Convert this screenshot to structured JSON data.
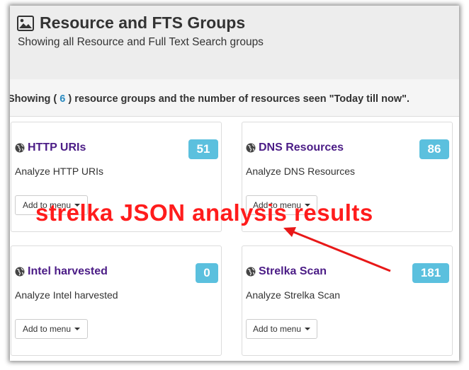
{
  "page": {
    "title": "Resource and FTS Groups",
    "subtitle": "Showing all Resource and Full Text Search groups"
  },
  "info": {
    "prefix": "Showing (",
    "count": "6",
    "suffix": ") resource groups and the number of resources seen \"Today till now\"."
  },
  "cards": [
    {
      "name": "HTTP URIs",
      "count": "51",
      "description": "Analyze HTTP URIs",
      "button": "Add to menu"
    },
    {
      "name": "DNS Resources",
      "count": "86",
      "description": "Analyze DNS Resources",
      "button": "Add to menu"
    },
    {
      "name": "Intel harvested",
      "count": "0",
      "description": "Analyze Intel harvested",
      "button": "Add to menu"
    },
    {
      "name": "Strelka Scan",
      "count": "181",
      "description": "Analyze Strelka Scan",
      "button": "Add to menu"
    }
  ],
  "annotation": {
    "text": "strelka JSON analysis results",
    "color": "#ff1c1c"
  },
  "colors": {
    "link": "#4b1c86",
    "badge": "#5bc0de",
    "count": "#2a8ac0"
  },
  "icons": {
    "title": "image-icon",
    "card": "globe-icon",
    "dropdown": "caret-down-icon"
  }
}
